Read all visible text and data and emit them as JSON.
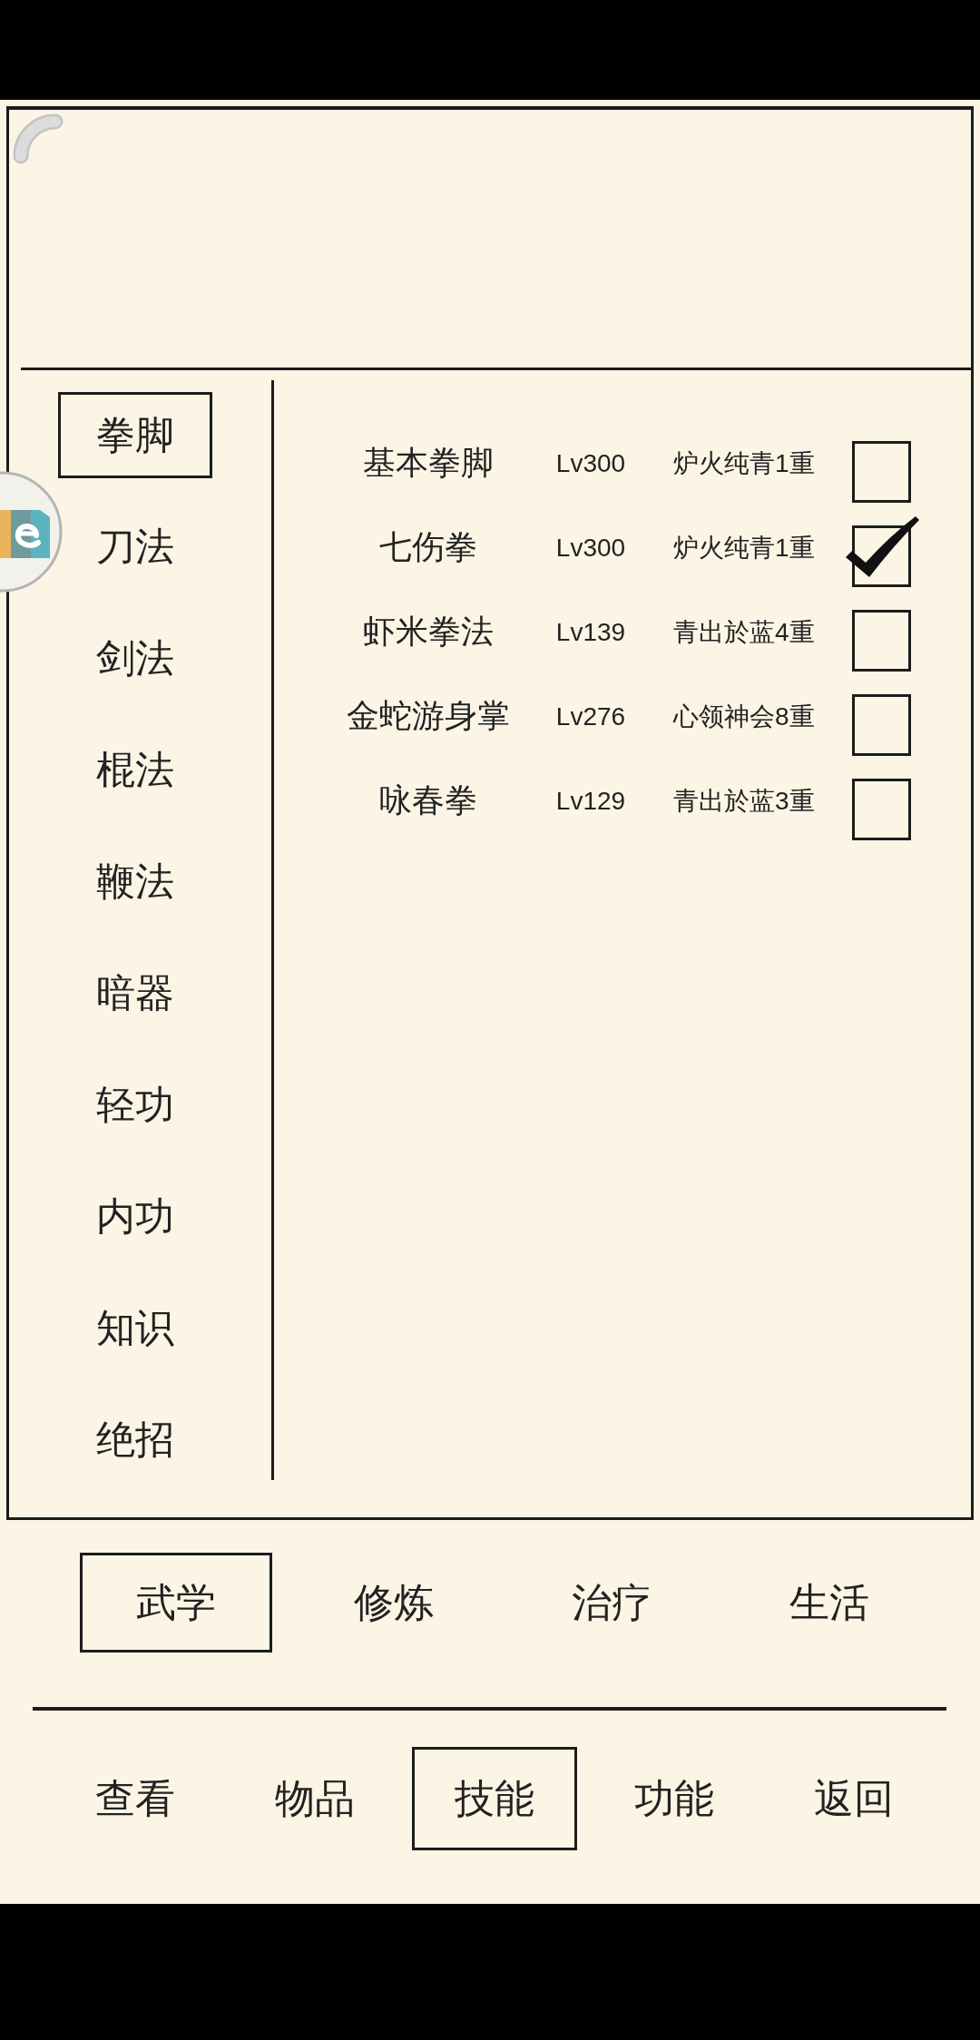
{
  "category_tabs": [
    {
      "label": "拳脚",
      "selected": true
    },
    {
      "label": "刀法",
      "selected": false
    },
    {
      "label": "剑法",
      "selected": false
    },
    {
      "label": "棍法",
      "selected": false
    },
    {
      "label": "鞭法",
      "selected": false
    },
    {
      "label": "暗器",
      "selected": false
    },
    {
      "label": "轻功",
      "selected": false
    },
    {
      "label": "内功",
      "selected": false
    },
    {
      "label": "知识",
      "selected": false
    },
    {
      "label": "绝招",
      "selected": false
    }
  ],
  "skills": [
    {
      "name": "基本拳脚",
      "rank": "Lv300",
      "stage": "炉火纯青1重",
      "checked": false
    },
    {
      "name": "七伤拳",
      "rank": "Lv300",
      "stage": "炉火纯青1重",
      "checked": true
    },
    {
      "name": "虾米拳法",
      "rank": "Lv139",
      "stage": "青出於蓝4重",
      "checked": false
    },
    {
      "name": "金蛇游身掌",
      "rank": "Lv276",
      "stage": "心领神会8重",
      "checked": false
    },
    {
      "name": "咏春拳",
      "rank": "Lv129",
      "stage": "青出於蓝3重",
      "checked": false
    }
  ],
  "section_tabs": [
    {
      "label": "武学",
      "selected": true
    },
    {
      "label": "修炼",
      "selected": false
    },
    {
      "label": "治疗",
      "selected": false
    },
    {
      "label": "生活",
      "selected": false
    }
  ],
  "nav_tabs": [
    {
      "label": "查看",
      "selected": false
    },
    {
      "label": "物品",
      "selected": false
    },
    {
      "label": "技能",
      "selected": true
    },
    {
      "label": "功能",
      "selected": false
    },
    {
      "label": "返回",
      "selected": false
    }
  ]
}
